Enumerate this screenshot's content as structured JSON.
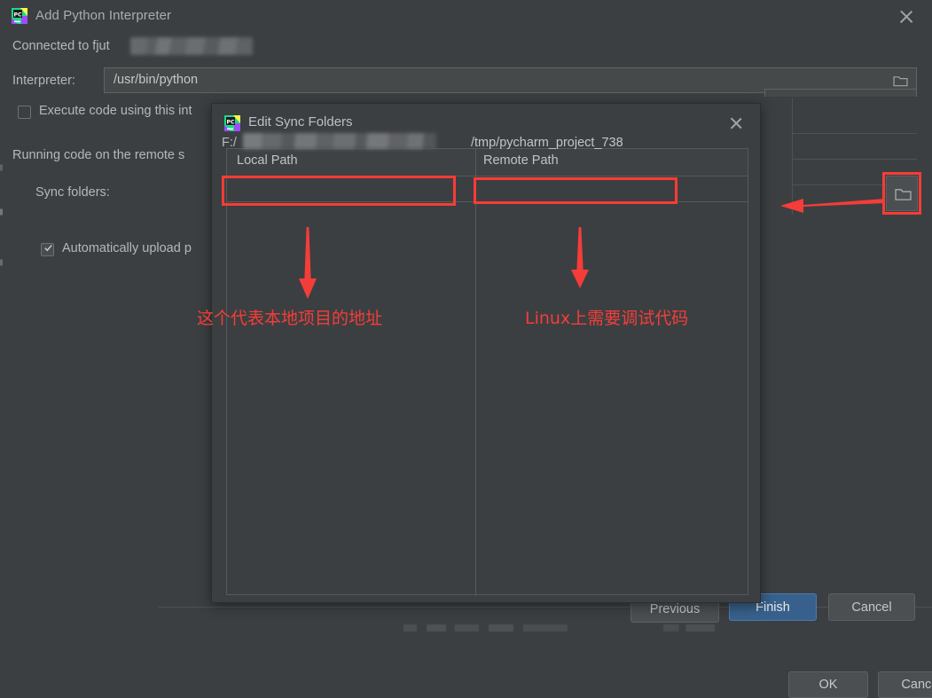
{
  "background_window": {
    "title": "Add Python Interpreter",
    "app_icon": "pycharm-icon",
    "close_icon": "close-icon",
    "connected_label": "Connected to fjut",
    "connected_redacted": "",
    "interpreter_label": "Interpreter:",
    "interpreter_value": "/usr/bin/python",
    "interpreter_browse_icon": "folder-icon",
    "execute_checkbox": {
      "label": "Execute code using this int",
      "checked": false
    },
    "running_note": "Running code on the remote s",
    "sync_folders_label": "Sync folders:",
    "sync_browse_icon": "folder-icon",
    "auto_upload_checkbox": {
      "label": "Automatically upload p",
      "checked": true
    },
    "buttons": {
      "previous": "Previous",
      "finish": "Finish",
      "cancel": "Cancel"
    }
  },
  "modal": {
    "title": "Edit Sync Folders",
    "app_icon": "pycharm-icon",
    "close_icon": "close-icon",
    "table": {
      "columns": [
        "Local Path",
        "Remote Path"
      ],
      "rows": [
        {
          "local_path_prefix": "F:/",
          "local_path_redacted": "",
          "remote_path": "/tmp/pycharm_project_738"
        }
      ]
    },
    "side_buttons": {
      "add": "+",
      "remove": "−"
    },
    "buttons": {
      "ok": "OK",
      "cancel": "Cancel"
    }
  },
  "annotations": {
    "color": "#f43d39",
    "local_note": "这个代表本地项目的地址",
    "remote_note": "Linux上需要调试代码",
    "highlight_local_field": true,
    "highlight_remote_field": true,
    "highlight_browse_button": true
  },
  "theme": {
    "window_bg": "#3c3f41",
    "field_bg": "#45494a",
    "border": "#555a5c",
    "text": "#b5b8ba",
    "accent_button": "#37618c",
    "annotation_red": "#f43d39"
  }
}
